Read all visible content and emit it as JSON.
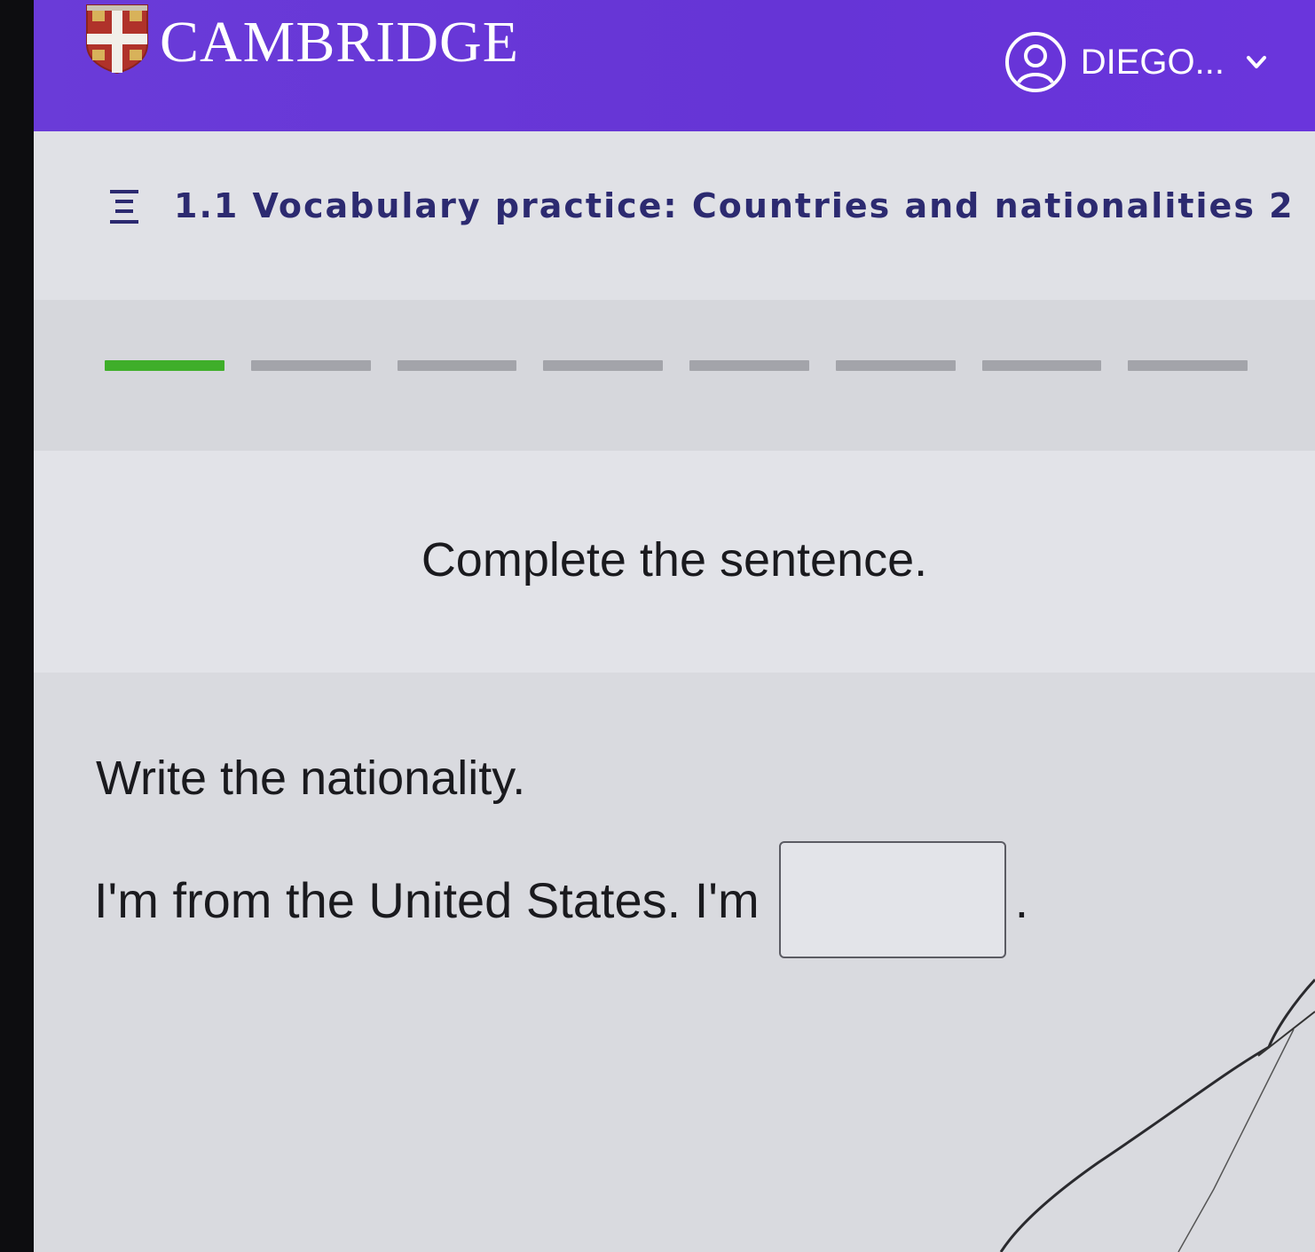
{
  "header": {
    "brand": "CAMBRIDGE",
    "user_name": "DIEGO...",
    "colors": {
      "background": "#6634d6",
      "text": "#ffffff"
    },
    "icons": {
      "logo": "cambridge-shield-logo",
      "avatar": "user-avatar-icon",
      "dropdown": "chevron-down-icon"
    }
  },
  "activity": {
    "title": "1.1 Vocabulary practice: Countries and nationalities 2",
    "menu_icon": "menu-list-icon",
    "title_color": "#2c2a70"
  },
  "progress": {
    "total_steps": 8,
    "completed_steps": 1,
    "colors": {
      "done": "#3fae2a",
      "pending": "#a3a4aa"
    }
  },
  "instruction": {
    "text": "Complete the sentence."
  },
  "question": {
    "heading": "Write the nationality.",
    "sentence_prefix": "I'm from the United States. I'm",
    "answer_value": "",
    "sentence_suffix": "."
  }
}
